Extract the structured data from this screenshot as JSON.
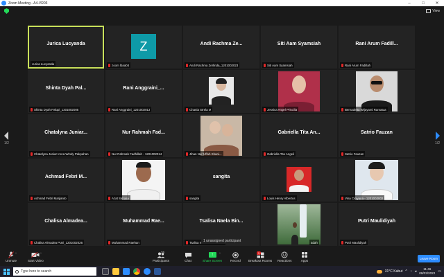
{
  "window": {
    "title": "Zoom Meeting - A4-VR03"
  },
  "top": {
    "view_label": "View"
  },
  "pager": {
    "left": "1/2",
    "right": "1/2"
  },
  "tiles": [
    {
      "big": "Jurica Lucyanda",
      "label": "Jurica Lucyanda",
      "active": true
    },
    {
      "big": "",
      "label": "zoom lbaa04",
      "avatar_letter": "Z"
    },
    {
      "big": "Andi Rachma Ze...",
      "label": "Andi Rachma Zerlinda_1201002023"
    },
    {
      "big": "Siti Aam Syamsiah",
      "label": "Siti Aam Syamsiah"
    },
    {
      "big": "Rani Arum Fadill...",
      "label": "Rani Arum Fadillah"
    },
    {
      "big": "Shinta Dyah Pal...",
      "label": "Shinta Dyah Palupi_1201002005"
    },
    {
      "big": "Rani Anggraini_...",
      "label": "Rani Anggraini_1201002013"
    },
    {
      "big": "",
      "label": "Chania Strela M"
    },
    {
      "big": "",
      "label": "Jessica Angel Priscilia"
    },
    {
      "big": "",
      "label": "Bernadetta Wijayanti Ramatua"
    },
    {
      "big": "Chatalyna Juniar...",
      "label": "Chatalyna Juniar Irena Windy Pakpahan"
    },
    {
      "big": "Nur Rahmah Fad...",
      "label": "Nur Rahmah Fadhillah - 1201002014"
    },
    {
      "big": "",
      "label": "Jihan Nur Uffah Shani..."
    },
    {
      "big": "Gabriella Tita An...",
      "label": "Gabriella Tita Angeli"
    },
    {
      "big": "Satrio Fauzan",
      "label": "Satrio Fauzan"
    },
    {
      "big": "Achmad Febri M...",
      "label": "Achmad Febri Marjianto"
    },
    {
      "big": "",
      "label": "Azat Sahasa"
    },
    {
      "big": "sangita",
      "label": "sangita"
    },
    {
      "big": "",
      "label": "Louis Henry Albertus"
    },
    {
      "big": "",
      "label": "Vina Ciniyana - 1201002002"
    },
    {
      "big": "Chalisa Almadea...",
      "label": "Chalisa Almadea Putri_1201002026"
    },
    {
      "big": "Muhammad Rae...",
      "label": "Muhammad Raehan"
    },
    {
      "big": "Tsalisa Naela Bin...",
      "label": "Tsalisa Naela Bintan Na..."
    },
    {
      "big": "",
      "label": "adah"
    },
    {
      "big": "Putri Maulidiyah",
      "label": "Putri Maulidiyah"
    }
  ],
  "unassigned": "1 unassigned participant",
  "toolbar": {
    "unmute": "Unmute",
    "start_video": "Start Video",
    "participants": "Participants",
    "participants_count": "26",
    "chat": "Chat",
    "share_screen": "Share Screen",
    "record": "Record",
    "breakout": "Breakout Rooms",
    "breakout_badge": "1",
    "reactions": "Reactions",
    "apps": "Apps",
    "leave": "Leave Room"
  },
  "taskbar": {
    "search_placeholder": "Type here to search",
    "weather": "31°C Kabut",
    "time": "11:46",
    "date": "08/03/2022"
  },
  "colors": {
    "accent": "#2d8cff",
    "active_border": "#c8e05a",
    "green": "#23d959",
    "muted_red": "#e02828",
    "avatar_teal": "#0e9aa7"
  }
}
